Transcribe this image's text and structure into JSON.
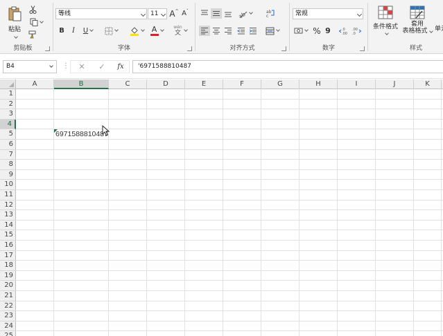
{
  "ribbon": {
    "clipboard": {
      "group_label": "剪贴板",
      "paste_label": "粘贴"
    },
    "font": {
      "group_label": "字体",
      "font_name": "等线",
      "font_size": "11",
      "increase_font": "A",
      "decrease_font": "A",
      "bold": "B",
      "italic": "I",
      "underline": "U",
      "font_color_letter": "A",
      "phonetic_label": "wén",
      "phonetic_glyph": "文"
    },
    "alignment": {
      "group_label": "对齐方式"
    },
    "number": {
      "group_label": "数字",
      "format": "常规",
      "percent": "%",
      "comma": "9"
    },
    "styles": {
      "group_label": "样式",
      "conditional_format": "条件格式",
      "table_format_line1": "套用",
      "table_format_line2": "表格格式",
      "cell_styles_partial": "单元"
    }
  },
  "formula_bar": {
    "name_box": "B4",
    "fx": "fx",
    "formula": "'6971588810487"
  },
  "columns": [
    "A",
    "B",
    "C",
    "D",
    "E",
    "F",
    "G",
    "H",
    "I",
    "J",
    "K"
  ],
  "rows": [
    "1",
    "2",
    "3",
    "4",
    "5",
    "6",
    "7",
    "8",
    "9",
    "10",
    "11",
    "12",
    "13",
    "14",
    "15",
    "16",
    "17",
    "18",
    "19",
    "20",
    "21",
    "22",
    "23",
    "24",
    "25"
  ],
  "active_cell": {
    "column": "B",
    "row": "4",
    "value": "6971588810487"
  },
  "colors": {
    "accent": "#217346",
    "font_color": "#e02020",
    "highlight": "#ffe000",
    "grid": "#e1e1e1"
  }
}
